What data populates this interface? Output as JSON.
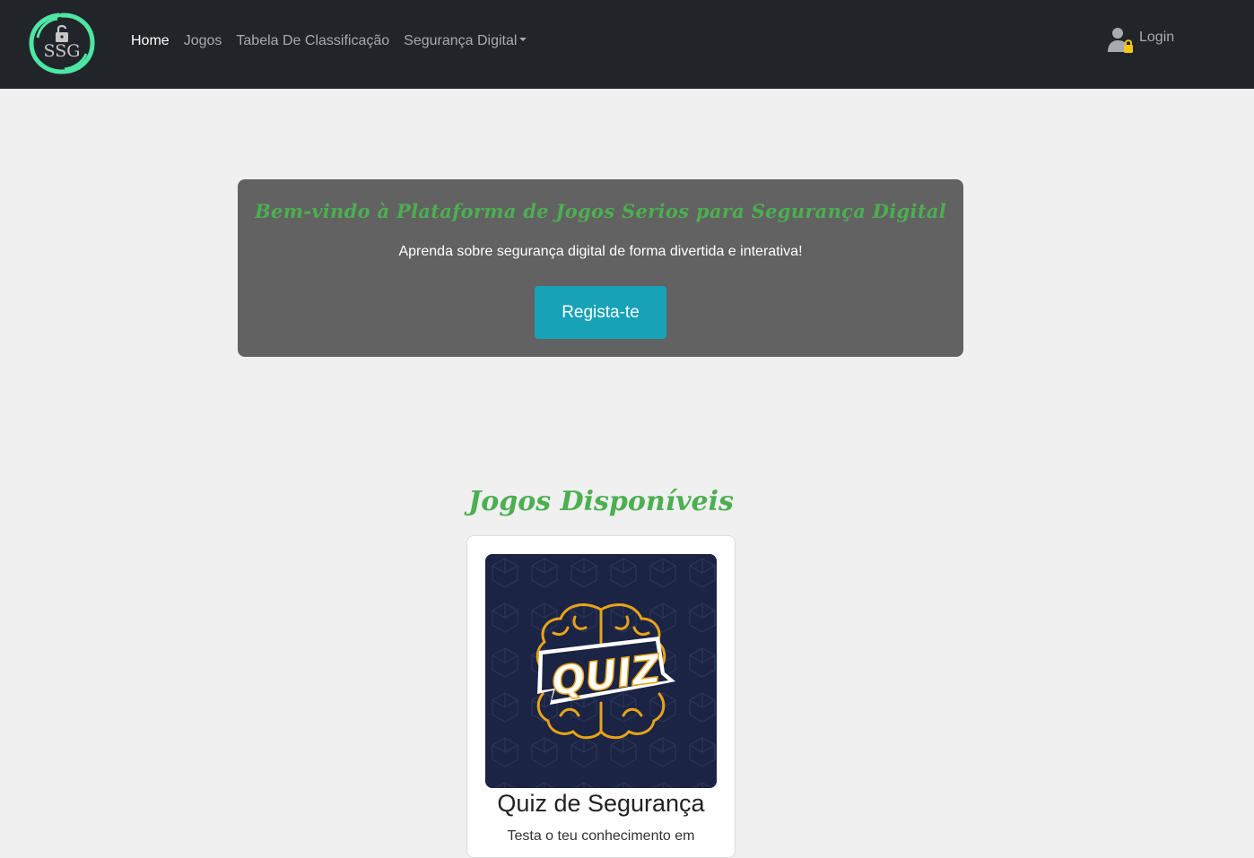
{
  "brand": {
    "logo_text": "SSG",
    "logo_ring_color": "#4ee6a4"
  },
  "nav": {
    "items": [
      {
        "label": "Home",
        "active": true
      },
      {
        "label": "Jogos",
        "active": false
      },
      {
        "label": "Tabela De Classificação",
        "active": false
      },
      {
        "label": "Segurança Digital",
        "active": false,
        "dropdown": true
      }
    ],
    "login_label": "Login",
    "login_icon": "user-lock-icon"
  },
  "hero": {
    "title": "Bem-vindo à Plataforma de Jogos Serios para Segurança Digital",
    "subtitle": "Aprenda sobre segurança digital de forma divertida e interativa!",
    "cta_label": "Regista-te"
  },
  "games_section": {
    "title": "Jogos Disponíveis",
    "games": [
      {
        "title": "Quiz de Segurança",
        "image_text": "QUIZ",
        "image_icon": "brain-quiz-icon",
        "description": "Testa o teu conhecimento em"
      }
    ]
  },
  "colors": {
    "navbar_bg": "#212529",
    "page_bg": "#f0f0f0",
    "hero_bg": "#626262",
    "accent_green": "#4caf50",
    "button_teal": "#17a2b8"
  }
}
